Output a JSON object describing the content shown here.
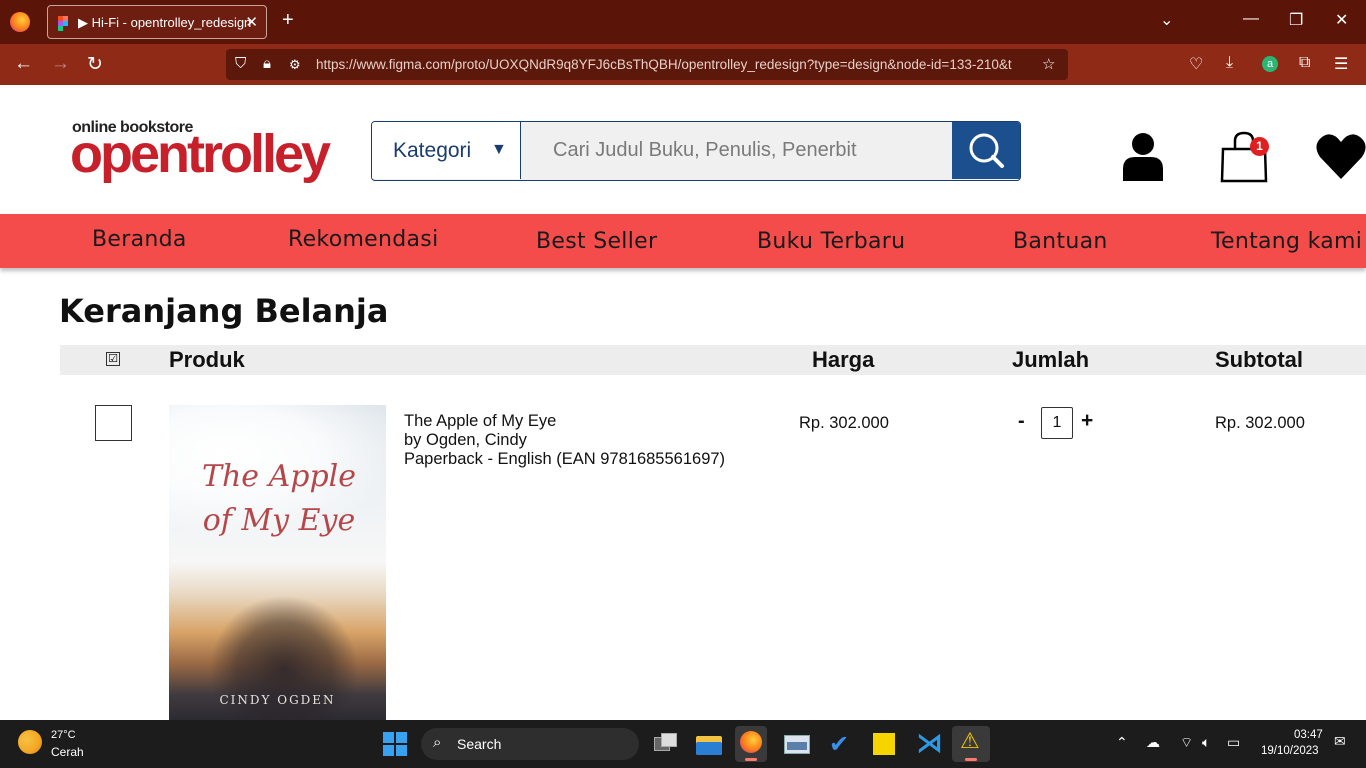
{
  "browser": {
    "tab_title": "▶ Hi-Fi - opentrolley_redesign",
    "tab_close": "✕",
    "new_tab": "+",
    "url": "https://www.figma.com/proto/UOXQNdR9q8YFJ6cBsThQBH/opentrolley_redesign?type=design&node-id=133-210&t",
    "window_controls": [
      "⌄",
      "—",
      "❐",
      "✕"
    ]
  },
  "site": {
    "logo_small": "online bookstore",
    "logo_big": "opentrolley",
    "category_label": "Kategori",
    "search_placeholder": "Cari Judul Buku, Penulis, Penerbit",
    "cart_badge": "1"
  },
  "menu": {
    "items": [
      "Beranda",
      "Rekomendasi",
      "Best Seller",
      "Buku Terbaru",
      "Bantuan",
      "Tentang kami"
    ]
  },
  "cart": {
    "title": "Keranjang Belanja",
    "header_check": "☑",
    "headers": {
      "produk": "Produk",
      "harga": "Harga",
      "jumlah": "Jumlah",
      "subtotal": "Subtotal"
    },
    "items": [
      {
        "title": "The Apple of My Eye",
        "author": "by Ogden, Cindy",
        "format": "Paperback - English (EAN 9781685561697)",
        "cover_title": "The Apple of My Eye",
        "cover_author": "CINDY OGDEN",
        "price": "Rp. 302.000",
        "qty_minus": "-",
        "qty": "1",
        "qty_plus": "+",
        "subtotal": "Rp. 302.000"
      }
    ]
  },
  "taskbar": {
    "temperature": "27°C",
    "weather": "Cerah",
    "search_label": "Search",
    "time": "03:47",
    "date": "19/10/2023"
  }
}
